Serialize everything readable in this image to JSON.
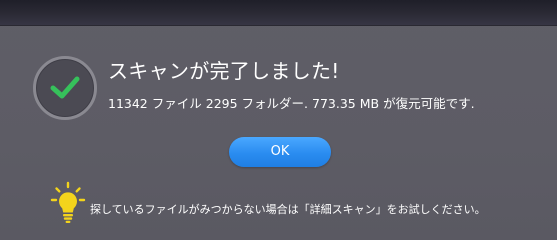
{
  "colors": {
    "title_bar": "#2b2a35",
    "background": "#5d5c65",
    "success": "#36c15b",
    "button": "#2a8cf0",
    "tip_icon": "#f3d41c",
    "text": "#ffffff"
  },
  "scan_result": {
    "status_icon": "check-circle-icon",
    "title": "スキャンが完了しました!",
    "summary": {
      "file_count": "11342",
      "file_label": "ファイル",
      "folder_count": "2295",
      "folder_label": "フォルダー.",
      "recoverable_size": "773.35 MB",
      "recoverable_label": "が復元可能です."
    }
  },
  "ok_button": {
    "label": "OK"
  },
  "tip": {
    "icon": "lightbulb-icon",
    "text": "探しているファイルがみつからない場合は「詳細スキャン」をお試しください。"
  }
}
